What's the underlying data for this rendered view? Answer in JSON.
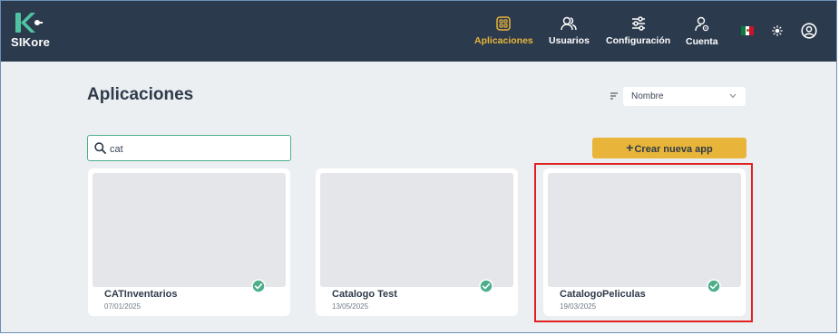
{
  "app": {
    "logo_text": "SIKore"
  },
  "nav": {
    "items": [
      {
        "label": "Aplicaciones",
        "icon": "apps-grid-icon",
        "active": true
      },
      {
        "label": "Usuarios",
        "icon": "users-icon",
        "active": false
      },
      {
        "label": "Configuración",
        "icon": "sliders-icon",
        "active": false
      },
      {
        "label": "Cuenta",
        "icon": "account-gear-icon",
        "active": false
      }
    ],
    "language_flag": "mexico-flag-icon",
    "theme_icon": "sun-icon",
    "profile_icon": "user-circle-icon"
  },
  "main": {
    "title": "Aplicaciones",
    "sort": {
      "selected": "Nombre"
    },
    "search": {
      "value": "cat"
    },
    "create_button": {
      "plus": "+",
      "label": "Crear nueva app"
    },
    "cards": [
      {
        "name": "CATInventarios",
        "date": "07/01/2025",
        "status": "active"
      },
      {
        "name": "Catalogo Test",
        "date": "13/05/2025",
        "status": "active"
      },
      {
        "name": "CatalogoPeliculas",
        "date": "19/03/2025",
        "status": "active"
      }
    ]
  },
  "colors": {
    "topbar": "#2c3a4d",
    "accent": "#e8b53a",
    "check_green": "#4caf8a",
    "highlight_red": "#e02020",
    "background": "#eceff2"
  }
}
